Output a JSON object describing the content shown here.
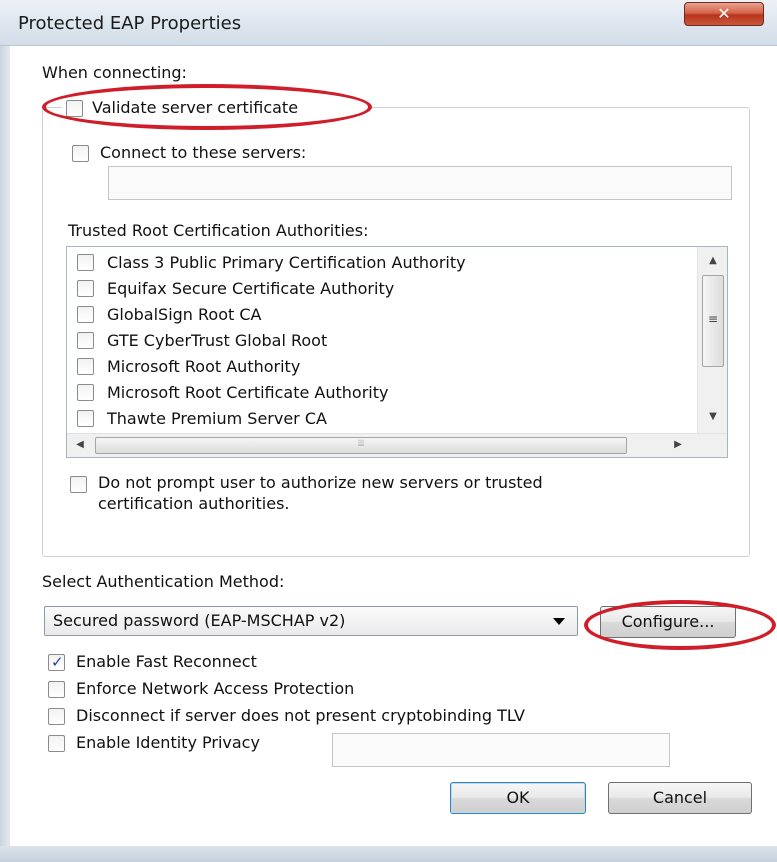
{
  "window": {
    "title": "Protected EAP Properties",
    "close_glyph": "✕"
  },
  "connecting": {
    "heading": "When connecting:",
    "validate_label": "Validate server certificate",
    "validate_checked": false,
    "connect_label": "Connect to these servers:",
    "connect_checked": false,
    "servers_value": ""
  },
  "trusted": {
    "heading": "Trusted Root Certification Authorities:",
    "items": [
      {
        "label": "Class 3 Public Primary Certification Authority",
        "checked": false
      },
      {
        "label": "Equifax Secure Certificate Authority",
        "checked": false
      },
      {
        "label": "GlobalSign Root CA",
        "checked": false
      },
      {
        "label": "GTE CyberTrust Global Root",
        "checked": false
      },
      {
        "label": "Microsoft Root Authority",
        "checked": false
      },
      {
        "label": "Microsoft Root Certificate Authority",
        "checked": false
      },
      {
        "label": "Thawte Premium Server CA",
        "checked": false
      }
    ]
  },
  "prompt": {
    "line1": "Do not prompt user to authorize new servers or trusted",
    "line2": "certification authorities.",
    "checked": false
  },
  "auth": {
    "heading": "Select Authentication Method:",
    "selected": "Secured password (EAP-MSCHAP v2)",
    "configure_label": "Configure..."
  },
  "options": [
    {
      "label": "Enable Fast Reconnect",
      "checked": true
    },
    {
      "label": "Enforce Network Access Protection",
      "checked": false
    },
    {
      "label": "Disconnect if server does not present cryptobinding TLV",
      "checked": false
    },
    {
      "label": "Enable Identity Privacy",
      "checked": false
    }
  ],
  "identity_privacy_value": "",
  "buttons": {
    "ok": "OK",
    "cancel": "Cancel"
  },
  "icons": {
    "scroll_up": "▲",
    "scroll_down": "▼",
    "scroll_left": "◀",
    "scroll_right": "▶",
    "grip_vertical": "≡",
    "grip_horizontal": "⦙⦙⦙"
  },
  "colors": {
    "highlight_ellipse": "#cf1e2a",
    "check_mark": "#21459c"
  }
}
